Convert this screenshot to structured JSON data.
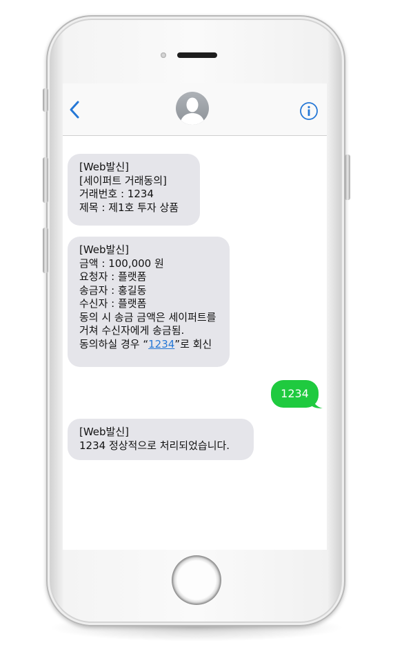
{
  "header": {
    "back_icon": "chevron-left-icon",
    "contact_icon": "person-silhouette-icon",
    "info_icon": "info-circle-icon",
    "accent_color": "#2477d6"
  },
  "messages": [
    {
      "direction": "incoming",
      "lines": [
        "[Web발신]",
        "[세이퍼트 거래동의]",
        "거래번호 : 1234",
        "제목 : 제1호 투자 상품"
      ]
    },
    {
      "direction": "incoming",
      "lines": [
        "[Web발신]",
        "금액 : 100,000 원",
        "요청자 : 플랫폼",
        "송금자 : 홍길동",
        "수신자 : 플랫폼",
        "동의 시 송금 금액은 세이퍼트를",
        "거쳐 수신자에게 송금됨."
      ],
      "last_line": {
        "prefix": "동의하실 경우 “",
        "link": "1234",
        "suffix": "”로 회신"
      }
    },
    {
      "direction": "outgoing",
      "text": "1234",
      "color": "#1fca3f"
    },
    {
      "direction": "incoming",
      "lines": [
        "[Web발신]",
        "1234 정상적으로 처리되었습니다."
      ]
    }
  ]
}
